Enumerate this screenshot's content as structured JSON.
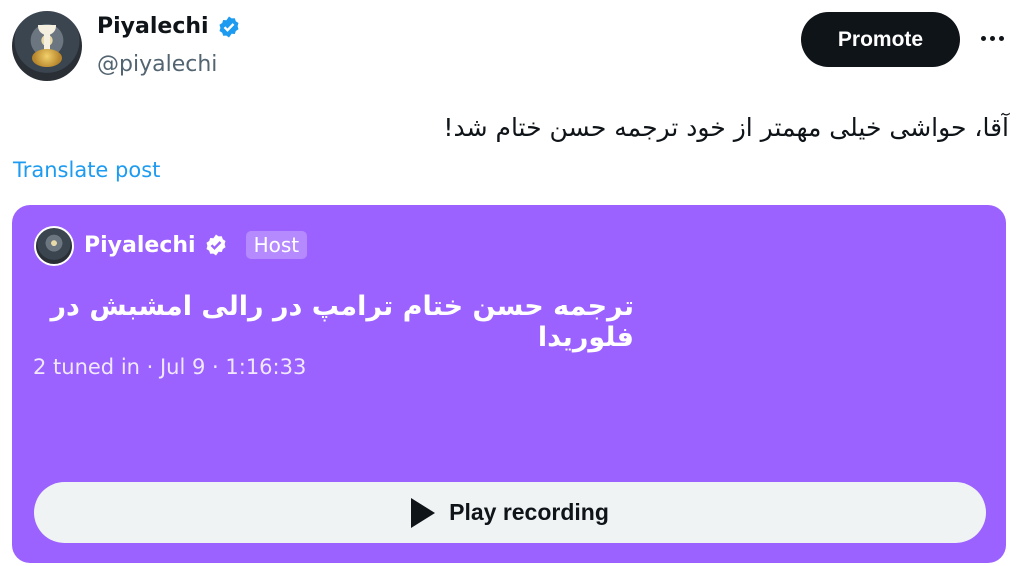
{
  "author": {
    "name": "Piyalechi",
    "handle": "@piyalechi",
    "verified": true,
    "avatar_icon": "chalice-avatar"
  },
  "actions": {
    "promote_label": "Promote",
    "more_icon": "more-horizontal-icon"
  },
  "post": {
    "text": "آقا، حواشی خیلی مهمتر از خود ترجمه حسن ختام شد!",
    "translate_label": "Translate post"
  },
  "space": {
    "background_color": "#9c62ff",
    "host_name": "Piyalechi",
    "host_tag": "Host",
    "title": "ترجمه حسن ختام ترامپ در رالی امشبش در فلوریدا",
    "meta": "2 tuned in · Jul 9 · 1:16:33",
    "play_label": "Play recording",
    "play_icon": "play-icon"
  },
  "colors": {
    "verified_blue": "#1d9bf0",
    "link_blue": "#1d9bf0",
    "button_dark": "#0f1419"
  }
}
